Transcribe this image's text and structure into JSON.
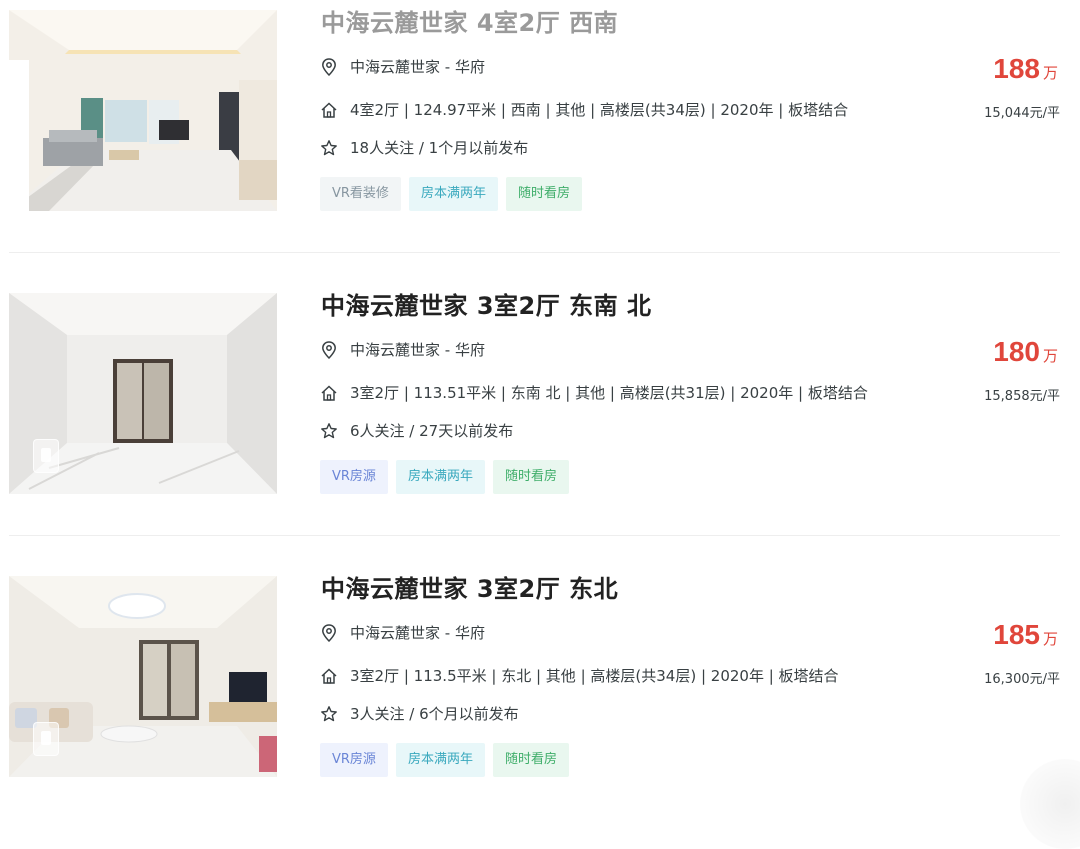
{
  "listings": [
    {
      "title": "中海云麓世家 4室2厅 西南",
      "location": "中海云麓世家 - 华府",
      "house_info": "4室2厅 | 124.97平米 | 西南 | 其他 | 高楼层(共34层) | 2020年 | 板塔结合",
      "follow_info": "18人关注 / 1个月以前发布",
      "tags": [
        "VR看装修",
        "房本满两年",
        "随时看房"
      ],
      "total_price": "188",
      "price_unit": "万",
      "unit_price": "15,044元/平"
    },
    {
      "title": "中海云麓世家 3室2厅 东南 北",
      "location": "中海云麓世家 - 华府",
      "house_info": "3室2厅 | 113.51平米 | 东南 北 | 其他 | 高楼层(共31层) | 2020年 | 板塔结合",
      "follow_info": "6人关注 / 27天以前发布",
      "tags": [
        "VR房源",
        "房本满两年",
        "随时看房"
      ],
      "total_price": "180",
      "price_unit": "万",
      "unit_price": "15,858元/平"
    },
    {
      "title": "中海云麓世家 3室2厅 东北",
      "location": "中海云麓世家 - 华府",
      "house_info": "3室2厅 | 113.5平米 | 东北 | 其他 | 高楼层(共34层) | 2020年 | 板塔结合",
      "follow_info": "3人关注 / 6个月以前发布",
      "tags": [
        "VR房源",
        "房本满两年",
        "随时看房"
      ],
      "total_price": "185",
      "price_unit": "万",
      "unit_price": "16,300元/平"
    }
  ],
  "icons": {
    "location": "location-pin-icon",
    "house": "house-icon",
    "follow": "star-icon"
  },
  "colors": {
    "price": "#e0463b",
    "tag_vr": "#6a85d6",
    "tag_tax": "#3aa9be",
    "tag_any": "#3fae6a"
  }
}
